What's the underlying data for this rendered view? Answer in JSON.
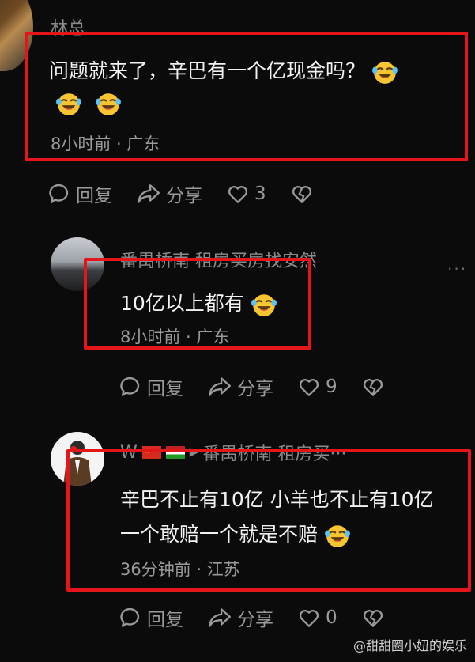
{
  "comment1": {
    "author": "林总",
    "text_line1": "问题就来了，辛巴有一个亿现金吗？",
    "meta": "8小时前 · 广东",
    "reply_label": "回复",
    "share_label": "分享",
    "like_count": "3"
  },
  "reply1": {
    "author": "番禺桥南 租房买房找安然",
    "text": "10亿以上都有",
    "meta": "8小时前 · 广东",
    "reply_label": "回复",
    "share_label": "分享",
    "like_count": "9",
    "more": "···"
  },
  "reply2": {
    "author": "W",
    "target": "番禺桥南 租房买···",
    "text_line1": "辛巴不止有10亿  小羊也不止有10亿",
    "text_line2": "一个敢赔一个就是不赔",
    "meta": "36分钟前 · 江苏",
    "reply_label": "回复",
    "share_label": "分享",
    "like_count": "0"
  },
  "watermark": "@甜甜圈小妞的娱乐",
  "colors": {
    "highlight_box": "#e4161b",
    "background": "#0b0b0b"
  }
}
